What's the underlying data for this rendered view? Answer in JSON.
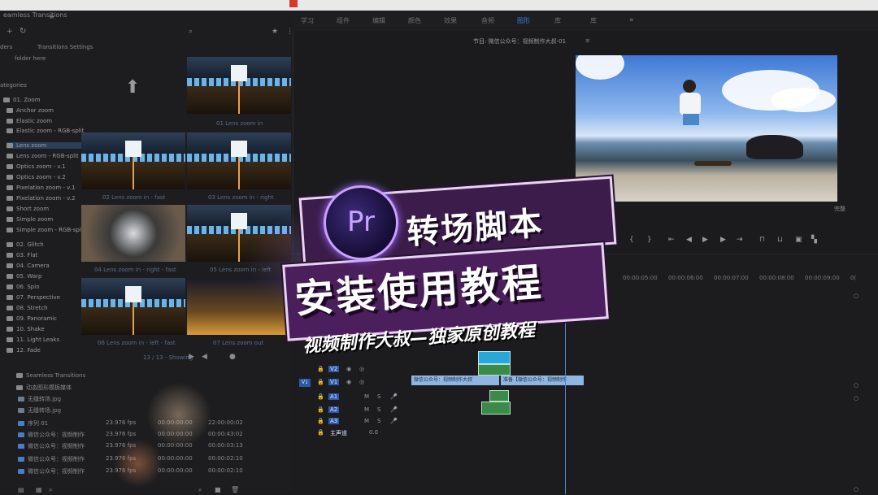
{
  "colors": {
    "accent": "#3a7cd6",
    "banner": "#4b1f5c",
    "clip": "#8fb6e0"
  },
  "workspaces": [
    {
      "label": "学习"
    },
    {
      "label": "组件"
    },
    {
      "label": "编辑"
    },
    {
      "label": "颜色"
    },
    {
      "label": "效果"
    },
    {
      "label": "音频"
    },
    {
      "label": "图形",
      "active": true
    },
    {
      "label": "库"
    },
    {
      "label": "库"
    }
  ],
  "project": {
    "title": "eamless Transitions",
    "tab1": "ders",
    "tab2": "Transitions Settings",
    "folder_hint": "folder here",
    "categories_header": "ategories",
    "categories": [
      "01. Zoom",
      "Anchor zoom",
      "Elastic zoom",
      "Elastic zoom - RGB-split",
      "Lens zoom",
      "Lens zoom - RGB-split",
      "Optics zoom - v.1",
      "Optics zoom - v.2",
      "Pixelation zoom - v.1",
      "Pixelation zoom - v.2",
      "Short zoom",
      "Simple zoom",
      "Simple zoom - RGB-split",
      "02. Glitch",
      "03. Flat",
      "04. Camera",
      "05. Warp",
      "06. Spin",
      "07. Perspective",
      "08. Stretch",
      "09. Panoramic",
      "10. Shake",
      "11. Light Leaks",
      "12. Fade"
    ],
    "thumbs": [
      "01 Lens zoom in",
      "02 Lens zoom in - fast",
      "03 Lens zoom in - right",
      "04 Lens zoom in - right - fast",
      "05 Lens zoom in - left",
      "06 Lens zoom in - left - fast",
      "07 Lens zoom out"
    ],
    "showing": "13 / 13 - Showing",
    "up_arrow": "up-arrow-icon"
  },
  "files": [
    {
      "name": "Seamless Transitions"
    },
    {
      "name": "动态图形模板媒体"
    },
    {
      "name": "无缝转场.jpg"
    },
    {
      "name": "无缝转场.jpg"
    },
    {
      "name": "序列 01",
      "fps": "23.976 fps",
      "start": "00:00:00:00",
      "end": "22:00:00:02"
    },
    {
      "name": "微信公众号：视频制作",
      "fps": "23.976 fps",
      "start": "00:00:00:00",
      "end": "00:00:43:02"
    },
    {
      "name": "微信公众号：视频制作",
      "fps": "23.976 fps",
      "start": "00:00:00:00",
      "end": "00:00:03:13"
    },
    {
      "name": "微信公众号：视频制作",
      "fps": "23.976 fps",
      "start": "00:00:00:00",
      "end": "00:00:02:10"
    },
    {
      "name": "微信公众号：视频制作",
      "fps": "23.976 fps",
      "start": "00:00:00:00",
      "end": "00:00:02:10"
    }
  ],
  "program": {
    "title": "节目: 微信公众号：视频制作大叔-01",
    "fit": "完整"
  },
  "timeline": {
    "timecodes": [
      "00:00:05:00",
      "00:00:06:00",
      "00:00:07:00",
      "00:00:08:00",
      "00:00:09:00"
    ],
    "tracks": [
      "V2",
      "V1",
      "A1",
      "A2",
      "A3",
      "主声道"
    ],
    "clip1": "微信公众号：视频制作大叔",
    "clip2": "准备【微信公众号：视频制作",
    "master_value": "0.0"
  },
  "overlay": {
    "logo": "Pr",
    "title1": "转场脚本",
    "title2": "安装使用教程",
    "subtitle": "视频制作大叔—独家原创教程"
  }
}
